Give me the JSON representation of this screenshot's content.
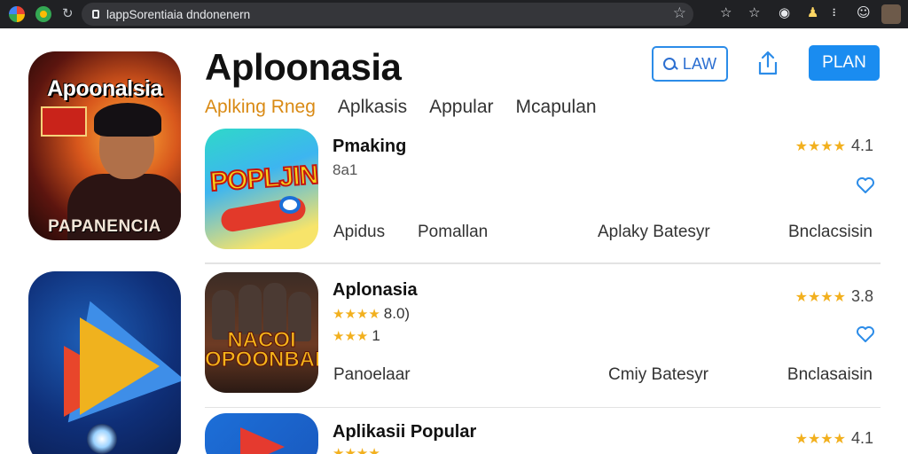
{
  "browser": {
    "url": "lappSorentiaia​ dndonenern",
    "star_icon": "star-icon"
  },
  "featured": [
    {
      "title": "Apoonalsia",
      "subtitle": "PAPANENCIA"
    },
    {
      "title": "",
      "subtitle": ""
    }
  ],
  "header": {
    "title": "Aploonasia",
    "search_label": "LAW",
    "primary_label": "PLAN"
  },
  "tabs": [
    {
      "label": "Aplking Rneg",
      "active": true
    },
    {
      "label": "Aplkasis",
      "active": false
    },
    {
      "label": "Appular",
      "active": false
    },
    {
      "label": "Mcapulan",
      "active": false
    }
  ],
  "apps": [
    {
      "name": "Pmaking",
      "subtitle": "8a1",
      "icon_text": "POPLJIN",
      "rating_stars": "★★★★",
      "rating": "4.1",
      "meta": [
        "Apidus",
        "Pomallan",
        "Aplaky Batesyr",
        "Bnclacsisin"
      ]
    },
    {
      "name": "Aplonasia",
      "icon_text": "NACOI OPOONBALA",
      "stars_line1": "★★★★",
      "stars_line1_num": "8.0)",
      "stars_line2": "★★★",
      "stars_line2_num": "1",
      "rating_stars": "★★★★",
      "rating": "3.8",
      "meta": [
        "Panoelaar",
        "Cmiy Batesyr",
        "Bnclasaisin"
      ]
    },
    {
      "name": "Aplikasii Popular",
      "stars_line1": "★★★★",
      "rating_stars": "★★★★",
      "rating": "4.1"
    }
  ]
}
